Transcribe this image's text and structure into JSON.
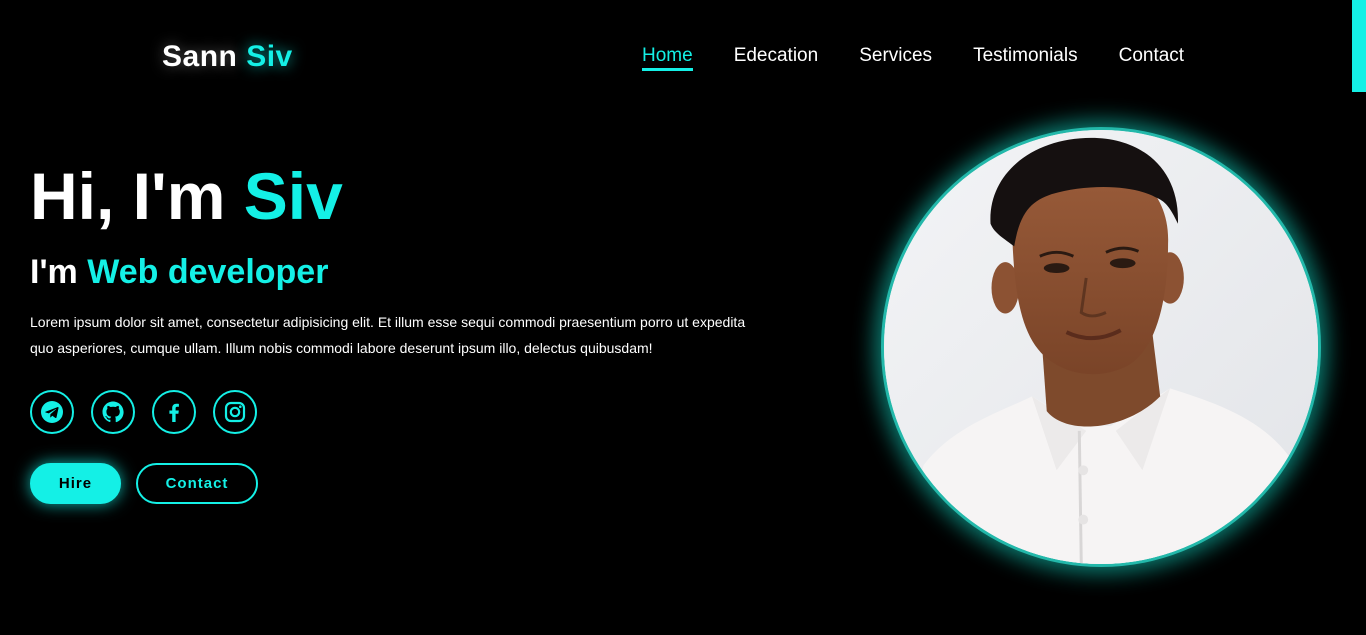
{
  "brand": {
    "first": "Sann",
    "accent": "Siv"
  },
  "nav": {
    "items": [
      {
        "label": "Home",
        "active": true
      },
      {
        "label": "Edecation",
        "active": false
      },
      {
        "label": "Services",
        "active": false
      },
      {
        "label": "Testimonials",
        "active": false
      },
      {
        "label": "Contact",
        "active": false
      }
    ]
  },
  "hero": {
    "greeting": "Hi, I'm",
    "name": "Siv",
    "role_prefix": "I'm",
    "role": "Web developer",
    "description": "Lorem ipsum dolor sit amet, consectetur adipisicing elit. Et illum esse sequi commodi praesentium porro ut expedita quo asperiores, cumque ullam. Illum nobis commodi labore deserunt ipsum illo, delectus quibusdam!",
    "socials": [
      {
        "icon": "telegram-icon"
      },
      {
        "icon": "github-icon"
      },
      {
        "icon": "facebook-icon"
      },
      {
        "icon": "instagram-icon"
      }
    ],
    "buttons": {
      "hire": "Hire",
      "contact": "Contact"
    }
  },
  "profile_image": {
    "icon": "profile-photo"
  },
  "colors": {
    "accent": "#14f0e6",
    "background": "#000000",
    "text": "#ffffff"
  }
}
